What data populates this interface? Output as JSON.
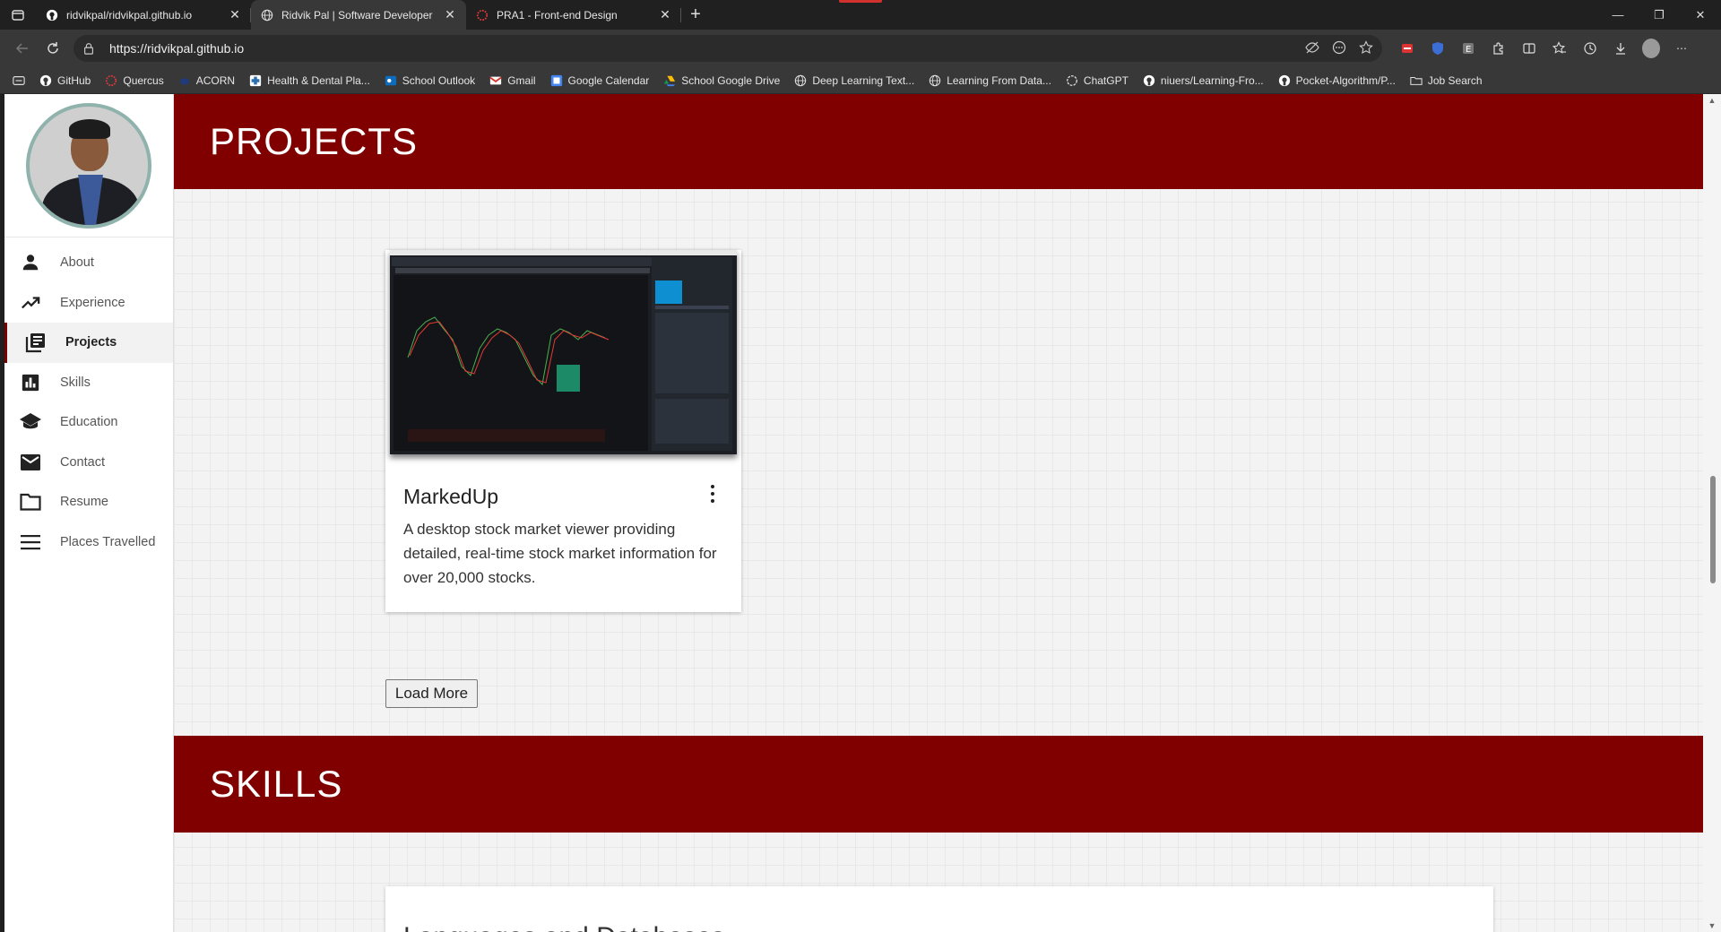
{
  "browser": {
    "tabs": [
      {
        "title": "ridvikpal/ridvikpal.github.io",
        "icon": "github-icon",
        "active": false
      },
      {
        "title": "Ridvik Pal | Software Developer",
        "icon": "globe-icon",
        "active": true
      },
      {
        "title": "PRA1 - Front-end Design",
        "icon": "quercus-icon",
        "active": false
      }
    ],
    "url": "https://ridvikpal.github.io",
    "bookmarks": [
      {
        "label": "GitHub",
        "icon": "github-icon"
      },
      {
        "label": "Quercus",
        "icon": "quercus-icon"
      },
      {
        "label": "ACORN",
        "icon": "acorn-icon"
      },
      {
        "label": "Health & Dental Pla...",
        "icon": "health-icon"
      },
      {
        "label": "School Outlook",
        "icon": "outlook-icon"
      },
      {
        "label": "Gmail",
        "icon": "gmail-icon"
      },
      {
        "label": "Google Calendar",
        "icon": "calendar-icon"
      },
      {
        "label": "School Google Drive",
        "icon": "drive-icon"
      },
      {
        "label": "Deep Learning Text...",
        "icon": "globe-icon"
      },
      {
        "label": "Learning From Data...",
        "icon": "globe-icon"
      },
      {
        "label": "ChatGPT",
        "icon": "chatgpt-icon"
      },
      {
        "label": "niuers/Learning-Fro...",
        "icon": "github-icon"
      },
      {
        "label": "Pocket-Algorithm/P...",
        "icon": "github-icon"
      },
      {
        "label": "Job Search",
        "icon": "folder-icon"
      }
    ]
  },
  "sidebar": {
    "items": [
      {
        "label": "About",
        "icon": "person-icon",
        "active": false
      },
      {
        "label": "Experience",
        "icon": "trending-up-icon",
        "active": false
      },
      {
        "label": "Projects",
        "icon": "library-books-icon",
        "active": true
      },
      {
        "label": "Skills",
        "icon": "bar-chart-icon",
        "active": false
      },
      {
        "label": "Education",
        "icon": "school-icon",
        "active": false
      },
      {
        "label": "Contact",
        "icon": "mail-icon",
        "active": false
      },
      {
        "label": "Resume",
        "icon": "folder-icon",
        "active": false
      },
      {
        "label": "Places Travelled",
        "icon": "menu-icon",
        "active": false
      }
    ]
  },
  "projects": {
    "heading": "PROJECTS",
    "cards": [
      {
        "title": "MarkedUp",
        "description": "A desktop stock market viewer providing detailed, real-time stock market information for over 20,000 stocks."
      }
    ],
    "load_more_label": "Load More"
  },
  "skills": {
    "heading": "SKILLS",
    "card_peek": "Languages and Databases"
  },
  "colors": {
    "section_header": "#800000",
    "accent": "#7a0000"
  }
}
